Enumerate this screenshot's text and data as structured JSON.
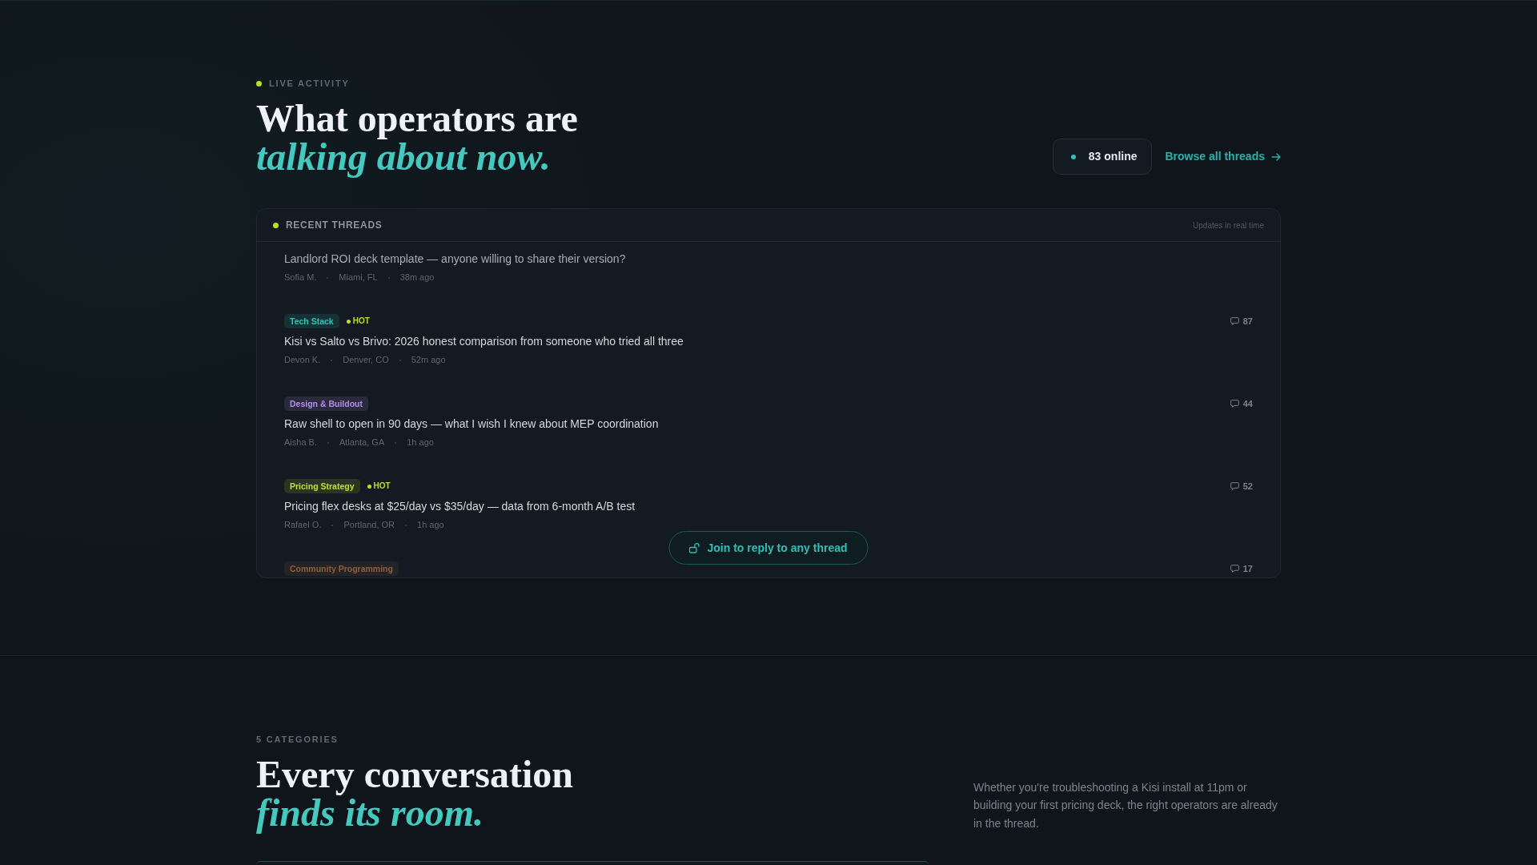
{
  "live_activity": {
    "label": "LIVE ACTIVITY",
    "title": "What operators are",
    "title_accent": "talking about now.",
    "online": "83 online",
    "browse_link": "Browse all threads"
  },
  "recent_threads": {
    "title": "RECENT THREADS",
    "status": "Updates in real time",
    "threads": [
      {
        "title": "Landlord ROI deck template — anyone willing to share their version?",
        "author": "Sofia M.",
        "location": "Miami, FL",
        "time": "38m ago"
      },
      {
        "category": {
          "label": "Tech Stack",
          "color": "#2ec4b6"
        },
        "badge": "HOT",
        "comments": "87",
        "title": "Kisi vs Salto vs Brivo: 2026 honest comparison from someone who tried all three",
        "author": "Devon K.",
        "location": "Denver, CO",
        "time": "52m ago"
      },
      {
        "category": {
          "label": "Design & Buildout",
          "color": "#b48ce8"
        },
        "comments": "44",
        "title": "Raw shell to open in 90 days — what I wish I knew about MEP coordination",
        "author": "Aisha B.",
        "location": "Atlanta, GA",
        "time": "1h ago"
      },
      {
        "category": {
          "label": "Pricing Strategy",
          "color": "#bde42c"
        },
        "badge": "HOT",
        "comments": "52",
        "title": "Pricing flex desks at $25/day vs $35/day — data from 6-month A/B test",
        "author": "Rafael O.",
        "location": "Portland, OR",
        "time": "1h ago"
      },
      {
        "category": {
          "label": "Community Programming",
          "color": "#8f5e3e"
        },
        "comments": "17"
      }
    ],
    "join_button": "Join to reply to any thread"
  },
  "categories": {
    "label": "5 CATEGORIES",
    "title": "Every conversation",
    "title_accent": "finds its room.",
    "description": "Whether you're troubleshooting a Kisi install at 11pm or building your first pricing deck, the right operators are already in the thread."
  }
}
